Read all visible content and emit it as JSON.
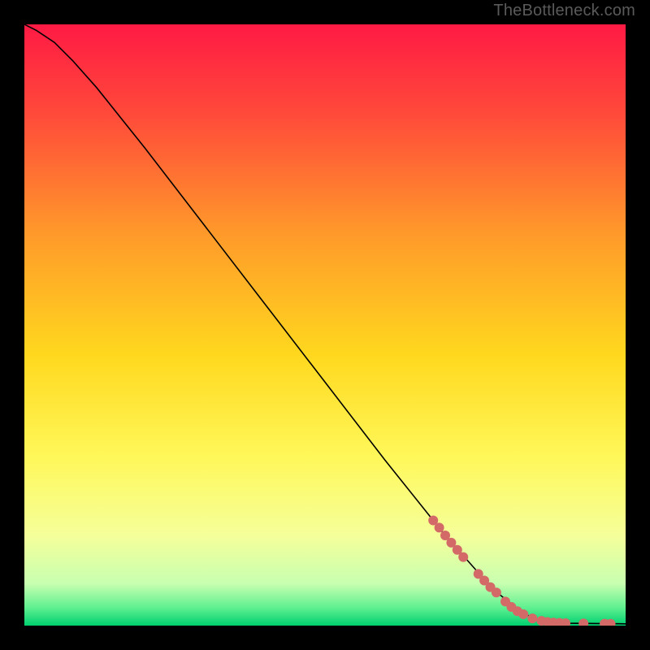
{
  "watermark": "TheBottleneck.com",
  "chart_data": {
    "type": "line",
    "title": "",
    "xlabel": "",
    "ylabel": "",
    "xlim": [
      0,
      100
    ],
    "ylim": [
      0,
      100
    ],
    "grid": false,
    "legend": false,
    "background_gradient": {
      "stops": [
        {
          "offset": 0.0,
          "color": "#ff1a44"
        },
        {
          "offset": 0.15,
          "color": "#ff4a3a"
        },
        {
          "offset": 0.35,
          "color": "#ff9a2a"
        },
        {
          "offset": 0.55,
          "color": "#ffd81e"
        },
        {
          "offset": 0.72,
          "color": "#fff85a"
        },
        {
          "offset": 0.85,
          "color": "#f5ff9a"
        },
        {
          "offset": 0.93,
          "color": "#c8ffb0"
        },
        {
          "offset": 0.97,
          "color": "#60f090"
        },
        {
          "offset": 1.0,
          "color": "#00d070"
        }
      ]
    },
    "series": [
      {
        "name": "curve",
        "type": "line",
        "color": "#000000",
        "data": [
          {
            "x": 0.0,
            "y": 100.0
          },
          {
            "x": 2.0,
            "y": 99.0
          },
          {
            "x": 5.0,
            "y": 97.0
          },
          {
            "x": 8.0,
            "y": 94.0
          },
          {
            "x": 12.0,
            "y": 89.5
          },
          {
            "x": 16.0,
            "y": 84.5
          },
          {
            "x": 20.0,
            "y": 79.5
          },
          {
            "x": 30.0,
            "y": 66.5
          },
          {
            "x": 40.0,
            "y": 53.5
          },
          {
            "x": 50.0,
            "y": 40.5
          },
          {
            "x": 60.0,
            "y": 27.5
          },
          {
            "x": 70.0,
            "y": 15.0
          },
          {
            "x": 78.0,
            "y": 6.0
          },
          {
            "x": 83.0,
            "y": 2.0
          },
          {
            "x": 86.0,
            "y": 0.8
          },
          {
            "x": 90.0,
            "y": 0.4
          },
          {
            "x": 100.0,
            "y": 0.3
          }
        ]
      },
      {
        "name": "markers",
        "type": "scatter",
        "color": "#d36a68",
        "radius": 6,
        "data": [
          {
            "x": 68.0,
            "y": 17.5
          },
          {
            "x": 69.0,
            "y": 16.3
          },
          {
            "x": 70.0,
            "y": 15.0
          },
          {
            "x": 71.0,
            "y": 13.8
          },
          {
            "x": 72.0,
            "y": 12.6
          },
          {
            "x": 73.0,
            "y": 11.4
          },
          {
            "x": 75.5,
            "y": 8.6
          },
          {
            "x": 76.5,
            "y": 7.5
          },
          {
            "x": 77.5,
            "y": 6.4
          },
          {
            "x": 78.5,
            "y": 5.5
          },
          {
            "x": 80.0,
            "y": 4.0
          },
          {
            "x": 81.0,
            "y": 3.1
          },
          {
            "x": 82.0,
            "y": 2.4
          },
          {
            "x": 83.0,
            "y": 1.9
          },
          {
            "x": 84.5,
            "y": 1.2
          },
          {
            "x": 86.0,
            "y": 0.8
          },
          {
            "x": 87.0,
            "y": 0.6
          },
          {
            "x": 88.0,
            "y": 0.5
          },
          {
            "x": 89.0,
            "y": 0.45
          },
          {
            "x": 90.0,
            "y": 0.4
          },
          {
            "x": 93.0,
            "y": 0.35
          },
          {
            "x": 96.5,
            "y": 0.32
          },
          {
            "x": 97.5,
            "y": 0.31
          }
        ]
      }
    ]
  }
}
